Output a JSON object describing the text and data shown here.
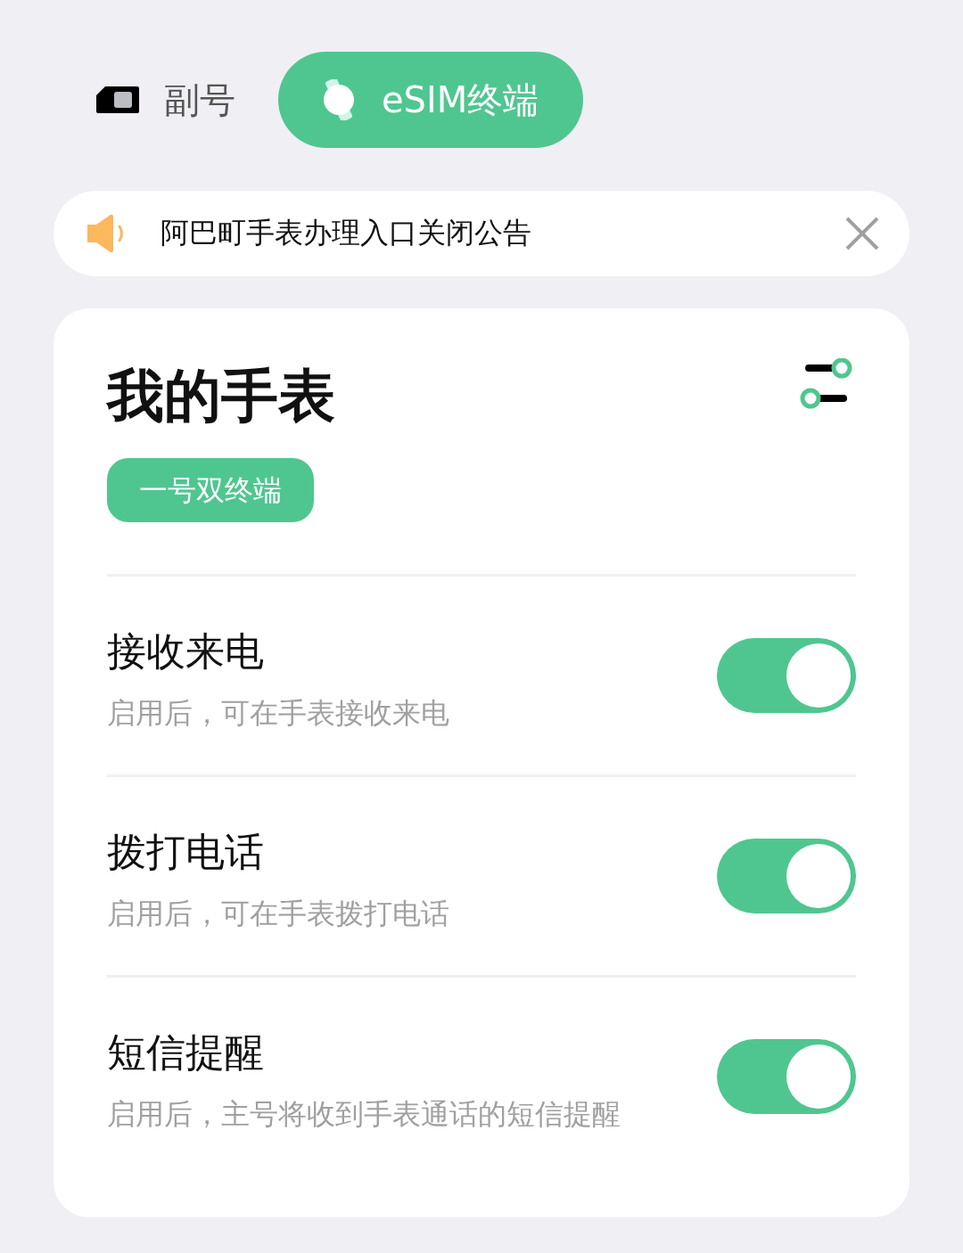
{
  "tabs": [
    {
      "kind": "sim",
      "label": "副号",
      "selected": false
    },
    {
      "kind": "watch",
      "label": "eSIM终端",
      "selected": true
    }
  ],
  "notice": {
    "text": "阿巴町手表办理入口关闭公告"
  },
  "card": {
    "title": "我的手表",
    "badge": "一号双终端",
    "settings": [
      {
        "title": "接收来电",
        "description": "启用后，可在手表接收来电",
        "on": true
      },
      {
        "title": "拨打电话",
        "description": "启用后，可在手表拨打电话",
        "on": true
      },
      {
        "title": "短信提醒",
        "description": "启用后，主号将收到手表通话的短信提醒",
        "on": true
      }
    ]
  }
}
